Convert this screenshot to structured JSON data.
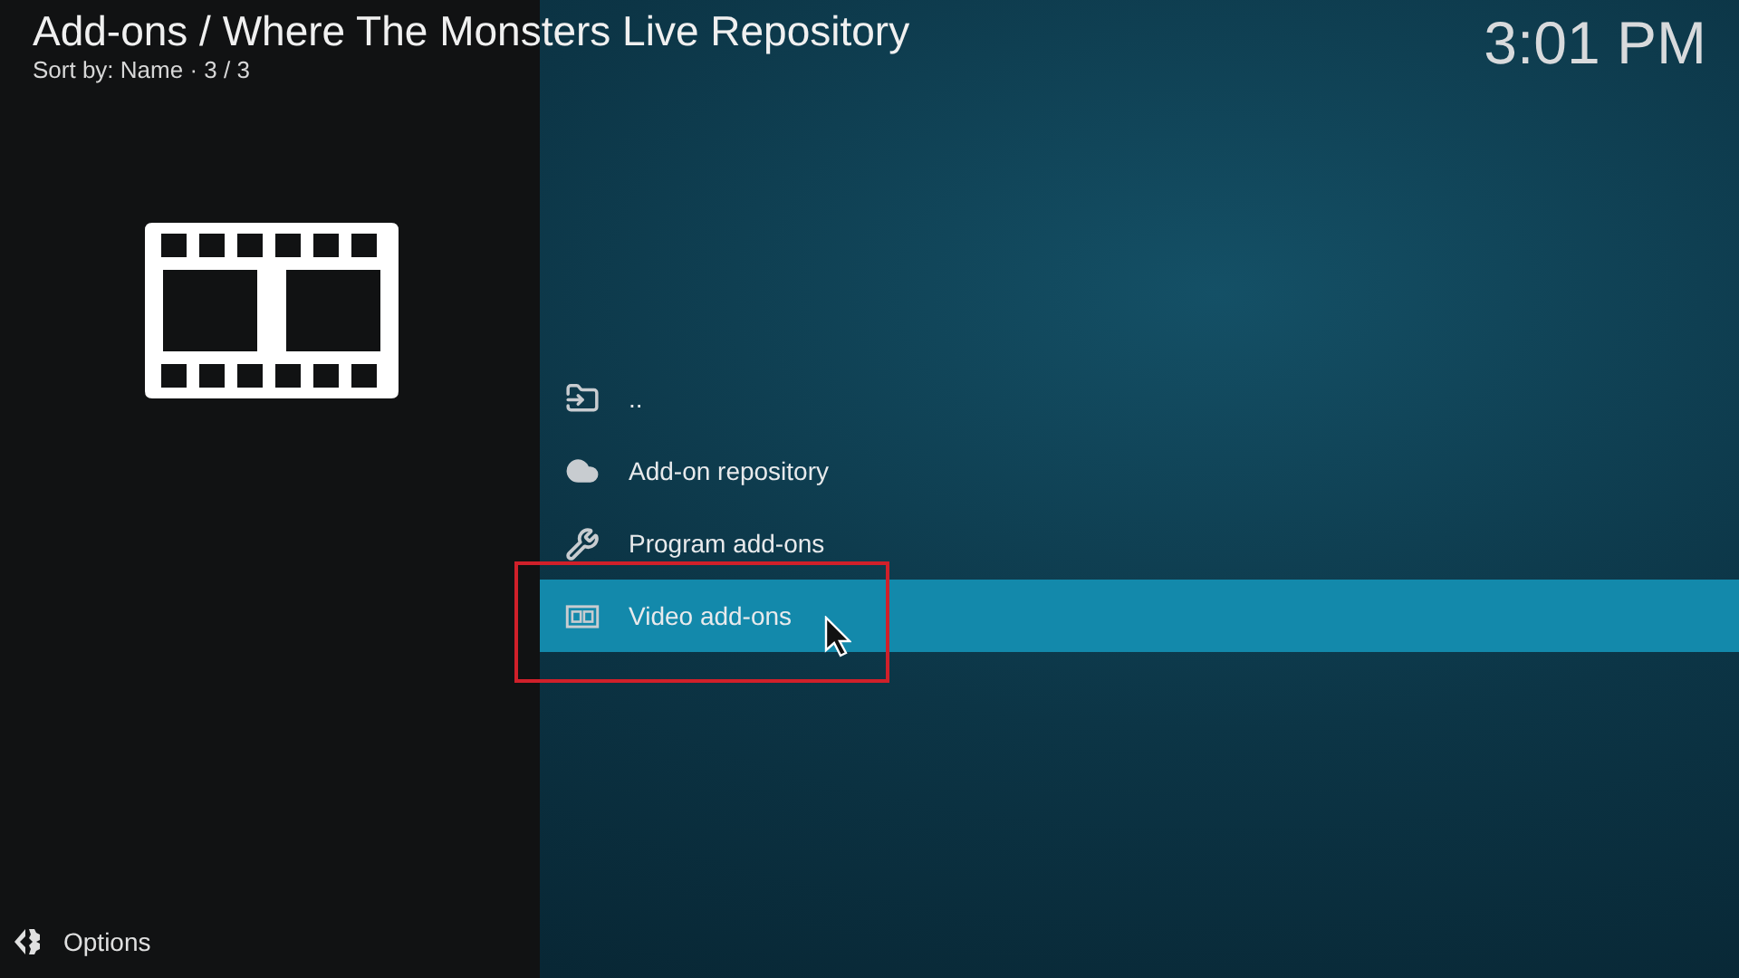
{
  "header": {
    "title": "Add-ons / Where The Monsters Live Repository",
    "subtitle": "Sort by: Name · 3 / 3",
    "clock": "3:01 PM"
  },
  "items": [
    {
      "label": "..",
      "kind": "parent",
      "selected": false
    },
    {
      "label": "Add-on repository",
      "kind": "cloud",
      "selected": false
    },
    {
      "label": "Program add-ons",
      "kind": "tools",
      "selected": false
    },
    {
      "label": "Video add-ons",
      "kind": "film",
      "selected": true
    }
  ],
  "footer": {
    "options": "Options"
  }
}
